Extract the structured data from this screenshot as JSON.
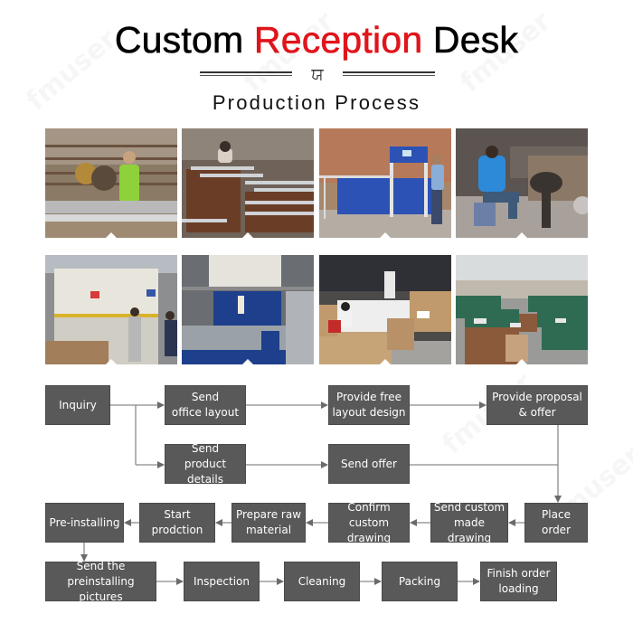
{
  "header": {
    "title_part1": "Custom",
    "title_part2": "Reception",
    "title_part3": "Desk",
    "ornament": "ਯ",
    "subtitle": "Production Process",
    "accent_color": "#e0141b"
  },
  "photos": [
    {
      "name": "cutting-aluminum-profiles",
      "desc": "Worker cutting metal profiles on saw"
    },
    {
      "name": "assembling-frames",
      "desc": "Worker assembling metal frames"
    },
    {
      "name": "cnc-machine",
      "desc": "Operator at blue CNC machine"
    },
    {
      "name": "grinding-polishing",
      "desc": "Worker polishing at grinder"
    },
    {
      "name": "press-brake-bending",
      "desc": "Workers at press brake"
    },
    {
      "name": "laser-cutting",
      "desc": "Blue laser cutting machine"
    },
    {
      "name": "packing-cartons",
      "desc": "Workers packing into cartons"
    },
    {
      "name": "warehouse-loading",
      "desc": "Packed goods in warehouse"
    }
  ],
  "flow": {
    "steps": {
      "inquiry": "Inquiry",
      "send_office_layout": "Send\noffice layout",
      "provide_free_layout": "Provide free\nlayout design",
      "provide_proposal": "Provide proposal\n& offer",
      "send_product_details": "Send\nproduct details",
      "send_offer": "Send offer",
      "place_order": "Place order",
      "send_custom_drawing": "Send custom\nmade drawing",
      "confirm_custom_drawing": "Confirm custom\ndrawing",
      "prepare_raw_material": "Prepare raw\nmaterial",
      "start_production": "Start prodction",
      "pre_installing": "Pre-installing",
      "send_preinstalling_pictures": "Send the preinstalling\npictures",
      "inspection": "Inspection",
      "cleaning": "Cleaning",
      "packing": "Packing",
      "finish_order_loading": "Finish order\nloading"
    },
    "box_color": "#595959",
    "line_color": "#7f7f7f"
  },
  "watermark": "fmuser"
}
